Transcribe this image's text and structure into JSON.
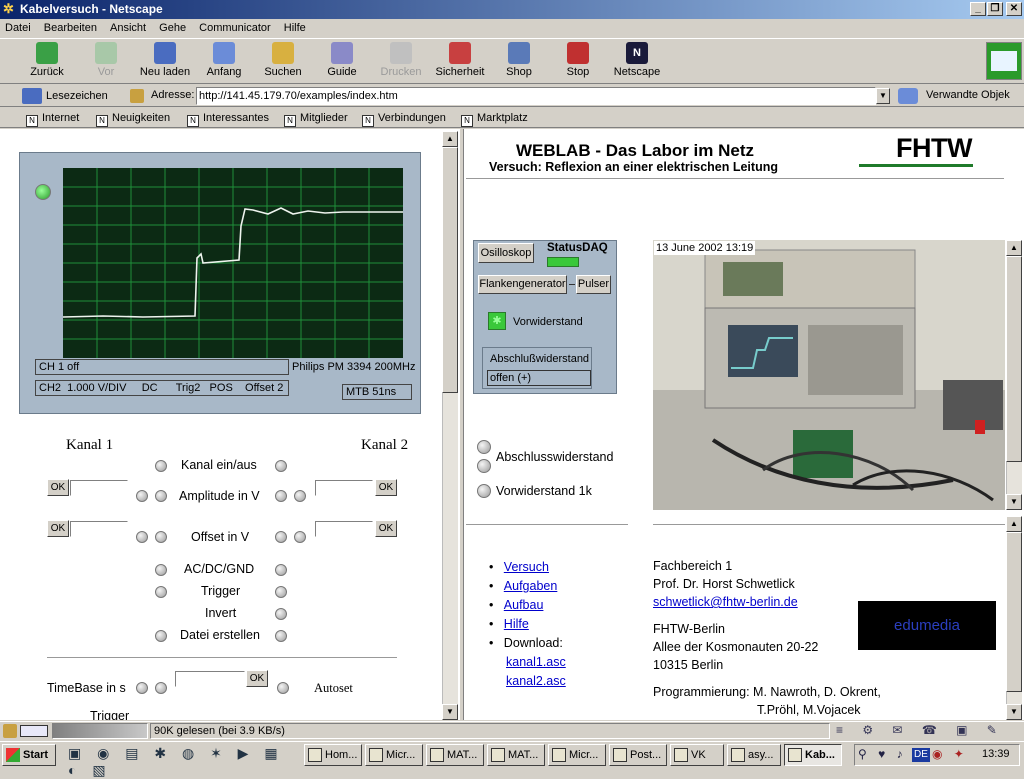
{
  "window": {
    "title": "Kabelversuch - Netscape"
  },
  "menu": [
    "Datei",
    "Bearbeiten",
    "Ansicht",
    "Gehe",
    "Communicator",
    "Hilfe"
  ],
  "toolbar": [
    {
      "label": "Zurück",
      "icon": "back-arrow-icon",
      "enabled": true
    },
    {
      "label": "Vor",
      "icon": "forward-arrow-icon",
      "enabled": false
    },
    {
      "label": "Neu laden",
      "icon": "reload-icon",
      "enabled": true
    },
    {
      "label": "Anfang",
      "icon": "home-icon",
      "enabled": true
    },
    {
      "label": "Suchen",
      "icon": "search-icon",
      "enabled": true
    },
    {
      "label": "Guide",
      "icon": "guide-icon",
      "enabled": true
    },
    {
      "label": "Drucken",
      "icon": "print-icon",
      "enabled": false
    },
    {
      "label": "Sicherheit",
      "icon": "lock-icon",
      "enabled": true
    },
    {
      "label": "Shop",
      "icon": "shop-icon",
      "enabled": true
    },
    {
      "label": "Stop",
      "icon": "stop-icon",
      "enabled": true
    },
    {
      "label": "Netscape",
      "icon": "netscape-logo-icon",
      "enabled": true
    }
  ],
  "address": {
    "bookmarks": "Lesezeichen",
    "label": "Adresse:",
    "url": "http://141.45.179.70/examples/index.htm",
    "related": "Verwandte Objek"
  },
  "personal_bar": [
    "Internet",
    "Neuigkeiten",
    "Interessantes",
    "Mitglieder",
    "Verbindungen",
    "Marktplatz"
  ],
  "oscilloscope": {
    "ch1": "CH 1 off",
    "model": "Philips PM 3394   200MHz",
    "ch2": "CH2  1.000 V/DIV     DC      Trig2   POS    Offset 2",
    "mtb": "MTB  51ns"
  },
  "controls": {
    "kanal1": "Kanal 1",
    "kanal2": "Kanal 2",
    "kanal_ein_aus": "Kanal ein/aus",
    "amplitude": "Amplitude in V",
    "offset": "Offset in V",
    "acdc": "AC/DC/GND",
    "trigger": "Trigger",
    "invert": "Invert",
    "datei": "Datei erstellen",
    "timebase": "TimeBase in s",
    "autoset": "Autoset",
    "trigger2": "Trigger",
    "ok": "OK"
  },
  "header": {
    "title": "WEBLAB - Das Labor im Netz",
    "subtitle": "Versuch: Reflexion an einer elektrischen Leitung",
    "logo": "FHTW"
  },
  "daq": {
    "oszilloskop": "Osilloskop",
    "status": "StatusDAQ",
    "flanken": "Flankengenerator",
    "pulser": "Pulser",
    "vorwiderstand": "Vorwiderstand",
    "abschluss": "Abschlußwiderstand",
    "offen": "offen (+)"
  },
  "options": {
    "abschluss": "Abschlusswiderstand",
    "vorwiderstand": "Vorwiderstand 1k"
  },
  "camera": {
    "timestamp": "13 June 2002 13:19"
  },
  "links": {
    "versuch": "Versuch",
    "aufgaben": "Aufgaben",
    "aufbau": "Aufbau",
    "hilfe": "Hilfe",
    "download": "Download:",
    "kanal1": "kanal1.asc",
    "kanal2": "kanal2.asc"
  },
  "contact": {
    "fb": "Fachbereich 1",
    "prof": "Prof. Dr. Horst Schwetlick",
    "email": "schwetlick@fhtw-berlin.de",
    "org": "FHTW-Berlin",
    "street": "Allee der Kosmonauten 20-22",
    "city": "10315 Berlin",
    "prog1": "Programmierung: M. Nawroth, D. Okrent,",
    "prog2": "T.Pröhl, M.Vojacek",
    "edumedia": "edumedia"
  },
  "status": {
    "text": "90K gelesen (bei 3.9 KB/s)"
  },
  "taskbar": {
    "start": "Start",
    "tasks": [
      "Hom...",
      "Micr...",
      "MAT...",
      "MAT...",
      "Micr...",
      "Post...",
      "VK",
      "asy...",
      "Kab..."
    ],
    "clock": "13:39",
    "lang": "DE"
  },
  "colors": {
    "title_bg": "#0a246a",
    "link": "#0000cc",
    "scope_bg": "#0c2a14",
    "grid": "#1f8f3a",
    "trace": "#e8f0e8",
    "edumedia_bg": "#000000",
    "edumedia_text": "#2b3fbf"
  }
}
